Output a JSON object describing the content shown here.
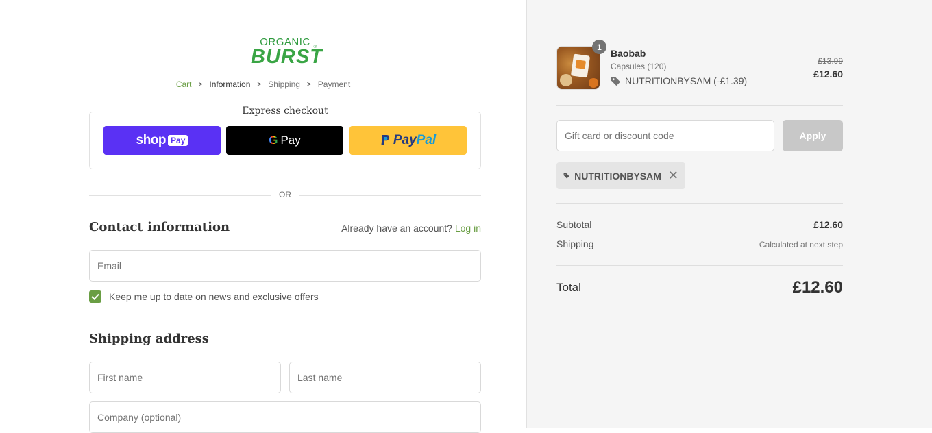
{
  "logo": {
    "line1": "ORGANIC",
    "line2": "BURST"
  },
  "breadcrumb": {
    "items": [
      "Cart",
      "Information",
      "Shipping",
      "Payment"
    ]
  },
  "express": {
    "title": "Express checkout",
    "shop_pay": {
      "text": "shop",
      "badge": "Pay"
    },
    "google_pay": {
      "g": "G",
      "text": "Pay"
    },
    "paypal": {
      "part1": "Pay",
      "part2": "Pal"
    }
  },
  "divider": {
    "text": "OR"
  },
  "contact": {
    "heading": "Contact information",
    "account_prompt": "Already have an account?",
    "login_link": "Log in",
    "email_placeholder": "Email",
    "newsletter_label": "Keep me up to date on news and exclusive offers",
    "newsletter_checked": true
  },
  "shipping": {
    "heading": "Shipping address",
    "first_name_placeholder": "First name",
    "last_name_placeholder": "Last name",
    "company_placeholder": "Company (optional)"
  },
  "cart": {
    "quantity": "1",
    "product_name": "Baobab",
    "product_variant": "Capsules (120)",
    "product_discount": "NUTRITIONBYSAM (-£1.39)",
    "price_original": "£13.99",
    "price_current": "£12.60"
  },
  "discount": {
    "placeholder": "Gift card or discount code",
    "apply_label": "Apply",
    "applied_code": "NUTRITIONBYSAM"
  },
  "summary": {
    "subtotal_label": "Subtotal",
    "subtotal_value": "£12.60",
    "shipping_label": "Shipping",
    "shipping_value": "Calculated at next step",
    "total_label": "Total",
    "total_value": "£12.60"
  },
  "colors": {
    "accent": "#6a9e44",
    "shop_pay": "#5a31f4",
    "paypal": "#ffc439",
    "sidebar_bg": "#f5f5f5"
  }
}
